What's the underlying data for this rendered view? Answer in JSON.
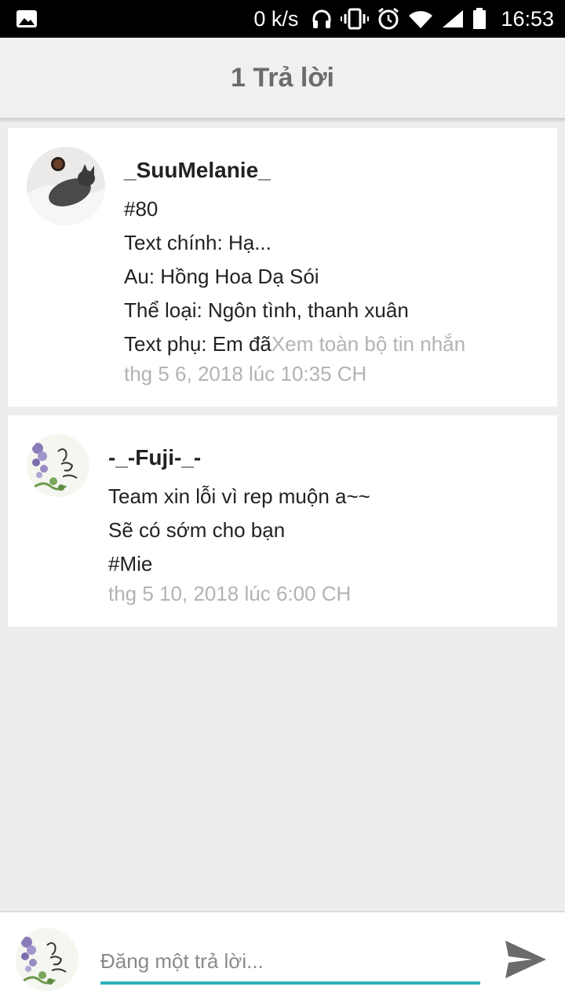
{
  "status_bar": {
    "net_speed": "0 k/s",
    "time": "16:53",
    "icons": [
      "image-icon",
      "headphones-icon",
      "vibrate-icon",
      "alarm-icon",
      "wifi-icon",
      "signal-icon",
      "battery-icon"
    ]
  },
  "header": {
    "title": "1 Trả lời"
  },
  "posts": [
    {
      "author": "_SuuMelanie_",
      "lines": [
        "#80",
        "Text chính: Hạ...",
        "Au: Hồng Hoa Dạ Sói",
        "Thể loại: Ngôn tình, thanh xuân"
      ],
      "last_line_prefix": "Text phụ: Em đã",
      "see_more": "Xem toàn bộ tin nhắn",
      "timestamp": "thg 5 6, 2018 lúc 10:35 CH"
    },
    {
      "author": "-_-Fuji-_-",
      "lines": [
        "Team xin lỗi vì rep muộn a~~",
        "Sẽ có sớm cho bạn",
        "#Mie"
      ],
      "timestamp": "thg 5 10, 2018 lúc 6:00 CH"
    }
  ],
  "reply": {
    "placeholder": "Đăng một trả lời..."
  },
  "colors": {
    "accent": "#2bb2b8",
    "background": "#ededed",
    "muted_text": "#b3b3b3"
  }
}
